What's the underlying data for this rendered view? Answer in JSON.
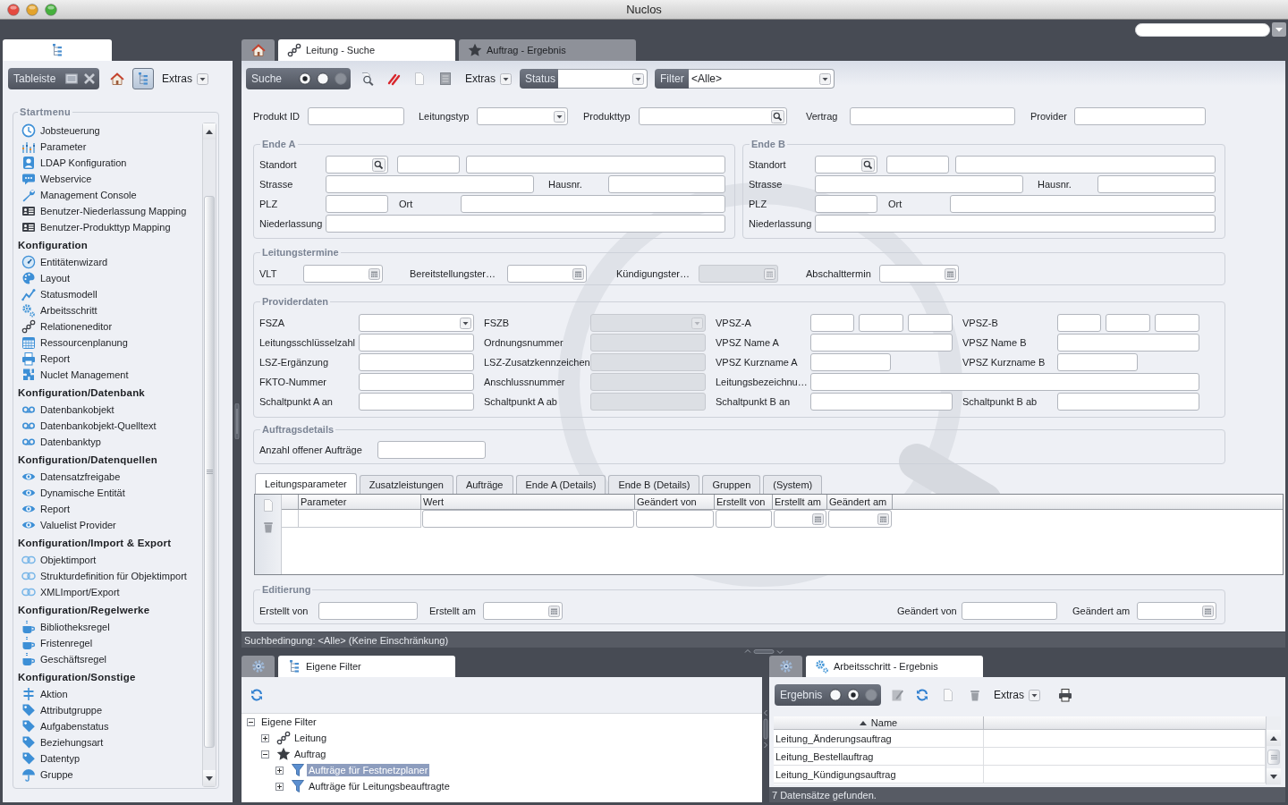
{
  "window": {
    "title": "Nuclos"
  },
  "sidebar": {
    "toolbar": {
      "label": "Tableiste",
      "tree_button_on": true,
      "extras": "Extras"
    },
    "startmenu": {
      "title": "Startmenu",
      "sections": [
        {
          "items": [
            {
              "label": "Jobsteuerung"
            },
            {
              "label": "Parameter"
            },
            {
              "label": "LDAP Konfiguration"
            },
            {
              "label": "Webservice"
            },
            {
              "label": "Management Console"
            },
            {
              "label": "Benutzer-Niederlassung Mapping"
            },
            {
              "label": "Benutzer-Produkttyp Mapping"
            }
          ]
        },
        {
          "heading": "Konfiguration",
          "items": [
            {
              "label": "Entitätenwizard"
            },
            {
              "label": "Layout"
            },
            {
              "label": "Statusmodell"
            },
            {
              "label": "Arbeitsschritt"
            },
            {
              "label": "Relationeneditor"
            },
            {
              "label": "Ressourcenplanung"
            },
            {
              "label": "Report"
            },
            {
              "label": "Nuclet Management"
            }
          ]
        },
        {
          "heading": "Konfiguration/Datenbank",
          "items": [
            {
              "label": "Datenbankobjekt"
            },
            {
              "label": "Datenbankobjekt-Quelltext"
            },
            {
              "label": "Datenbanktyp"
            }
          ]
        },
        {
          "heading": "Konfiguration/Datenquellen",
          "items": [
            {
              "label": "Datensatzfreigabe"
            },
            {
              "label": "Dynamische Entität"
            },
            {
              "label": "Report"
            },
            {
              "label": "Valuelist Provider"
            }
          ]
        },
        {
          "heading": "Konfiguration/Import & Export",
          "items": [
            {
              "label": "Objektimport"
            },
            {
              "label": "Strukturdefinition für Objektimport"
            },
            {
              "label": "XMLImport/Export"
            }
          ]
        },
        {
          "heading": "Konfiguration/Regelwerke",
          "items": [
            {
              "label": "Bibliotheksregel"
            },
            {
              "label": "Fristenregel"
            },
            {
              "label": "Geschäftsregel"
            }
          ]
        },
        {
          "heading": "Konfiguration/Sonstige",
          "items": [
            {
              "label": "Aktion"
            },
            {
              "label": "Attributgruppe"
            },
            {
              "label": "Aufgabenstatus"
            },
            {
              "label": "Beziehungsart"
            },
            {
              "label": "Datentyp"
            },
            {
              "label": "Gruppe"
            }
          ]
        }
      ]
    }
  },
  "main": {
    "tabs": [
      {
        "selected": false
      },
      {
        "label": "Leitung - Suche",
        "selected": true
      },
      {
        "label": "Auftrag - Ergebnis",
        "selected": false
      }
    ],
    "toolbar": {
      "mode": {
        "label": "Suche",
        "options": [
          {
            "selected": true,
            "disabled": false
          },
          {
            "selected": false,
            "disabled": false
          },
          {
            "selected": false,
            "disabled": true
          }
        ]
      },
      "extras": "Extras",
      "status": {
        "label": "Status"
      },
      "filter": {
        "label": "Filter",
        "value": "<Alle>"
      }
    },
    "search_fields": [
      {
        "label": "Produkt ID",
        "kind": "text"
      },
      {
        "label": "Leitungstyp",
        "kind": "combo"
      },
      {
        "label": "Produkttyp",
        "kind": "lookup"
      },
      {
        "label": "Vertrag",
        "kind": "text"
      },
      {
        "label": "Provider",
        "kind": "text"
      }
    ],
    "ends": [
      {
        "title": "Ende A",
        "standort": "Standort",
        "strasse": "Strasse",
        "hausnr": "Hausnr.",
        "plz": "PLZ",
        "ort": "Ort",
        "niederlassung": "Niederlassung"
      },
      {
        "title": "Ende B",
        "standort": "Standort",
        "strasse": "Strasse",
        "hausnr": "Hausnr.",
        "plz": "PLZ",
        "ort": "Ort",
        "niederlassung": "Niederlassung"
      }
    ],
    "leitungstermine": {
      "title": "Leitungstermine",
      "fields": [
        {
          "label": "VLT",
          "disabled": false
        },
        {
          "label": "Bereitstellungster…",
          "disabled": false
        },
        {
          "label": "Kündigungster…",
          "disabled": true
        },
        {
          "label": "Abschalttermin",
          "disabled": false
        }
      ]
    },
    "providerdaten": {
      "title": "Providerdaten",
      "rows": [
        [
          {
            "label": "FSZA",
            "kind": "combo",
            "disabled": false
          },
          {
            "label": "FSZB",
            "kind": "combo",
            "disabled": true
          },
          {
            "label": "VPSZ-A",
            "kind": "triple",
            "disabled": false
          },
          {
            "label": "VPSZ-B",
            "kind": "triple",
            "disabled": false
          }
        ],
        [
          {
            "label": "Leitungsschlüsselzahl",
            "kind": "text",
            "disabled": false
          },
          {
            "label": "Ordnungsnummer",
            "kind": "text",
            "disabled": true
          },
          {
            "label": "VPSZ Name A",
            "kind": "text",
            "disabled": false
          },
          {
            "label": "VPSZ Name B",
            "kind": "text",
            "disabled": false
          }
        ],
        [
          {
            "label": "LSZ-Ergänzung",
            "kind": "text",
            "disabled": false
          },
          {
            "label": "LSZ-Zusatzkennzeichen",
            "kind": "text",
            "disabled": true
          },
          {
            "label": "VPSZ Kurzname A",
            "kind": "short",
            "disabled": false
          },
          {
            "label": "VPSZ Kurzname B",
            "kind": "short",
            "disabled": false
          }
        ],
        [
          {
            "label": "FKTO-Nummer",
            "kind": "text",
            "disabled": false
          },
          {
            "label": "Anschlussnummer",
            "kind": "text",
            "disabled": true
          },
          {
            "label": "Leitungsbezeichnu…",
            "kind": "wide",
            "disabled": false
          }
        ],
        [
          {
            "label": "Schaltpunkt A an",
            "kind": "text",
            "disabled": false
          },
          {
            "label": "Schaltpunkt A ab",
            "kind": "text",
            "disabled": true
          },
          {
            "label": "Schaltpunkt B an",
            "kind": "text",
            "disabled": false
          },
          {
            "label": "Schaltpunkt B ab",
            "kind": "text",
            "disabled": false
          }
        ]
      ]
    },
    "auftragsdetails": {
      "title": "Auftragsdetails",
      "fields": [
        {
          "label": "Anzahl offener Aufträge"
        }
      ]
    },
    "subform": {
      "tabs": [
        {
          "label": "Leitungsparameter",
          "selected": true
        },
        {
          "label": "Zusatzleistungen",
          "selected": false
        },
        {
          "label": "Aufträge",
          "selected": false
        },
        {
          "label": "Ende A (Details)",
          "selected": false
        },
        {
          "label": "Ende B (Details)",
          "selected": false
        },
        {
          "label": "Gruppen",
          "selected": false
        },
        {
          "label": "(System)",
          "selected": false
        }
      ],
      "columns": [
        {
          "label": "Parameter",
          "kind": "plain"
        },
        {
          "label": "Wert",
          "kind": "text"
        },
        {
          "label": "Geändert von",
          "kind": "text"
        },
        {
          "label": "Erstellt von",
          "kind": "text"
        },
        {
          "label": "Erstellt am",
          "kind": "date"
        },
        {
          "label": "Geändert am",
          "kind": "date"
        }
      ]
    },
    "editierung": {
      "title": "Editierung",
      "left": [
        {
          "label": "Erstellt von",
          "kind": "text"
        },
        {
          "label": "Erstellt am",
          "kind": "date"
        }
      ],
      "right": [
        {
          "label": "Geändert von",
          "kind": "text"
        },
        {
          "label": "Geändert am",
          "kind": "date"
        }
      ]
    },
    "status_bar": "Suchbedingung: <Alle> (Keine Einschränkung)"
  },
  "filter_panel": {
    "tabs": [
      {
        "selected": false
      },
      {
        "label": "Eigene Filter",
        "selected": true
      }
    ],
    "tree": [
      {
        "label": "Eigene Filter",
        "expanded": true,
        "selected": false,
        "children": [
          {
            "label": "Leitung",
            "expanded": false,
            "selected": false
          },
          {
            "label": "Auftrag",
            "expanded": true,
            "selected": false,
            "children": [
              {
                "label": "Aufträge für Festnetzplaner",
                "expanded": false,
                "selected": true
              },
              {
                "label": "Aufträge für Leitungsbeauftragte",
                "expanded": false,
                "selected": false
              }
            ]
          }
        ]
      }
    ]
  },
  "result_panel": {
    "tabs": [
      {
        "selected": false
      },
      {
        "label": "Arbeitsschritt - Ergebnis",
        "selected": true
      }
    ],
    "toolbar": {
      "mode": {
        "label": "Ergebnis",
        "options": [
          {
            "selected": false,
            "disabled": false
          },
          {
            "selected": true,
            "disabled": false
          },
          {
            "selected": false,
            "disabled": true
          }
        ]
      },
      "extras": "Extras"
    },
    "table": {
      "columns": [
        {
          "label": "Name",
          "sort_ascending": true
        }
      ],
      "rows": [
        {
          "name": "Leitung_Änderungsauftrag"
        },
        {
          "name": "Leitung_Bestellauftrag"
        },
        {
          "name": "Leitung_Kündigungsauftrag"
        }
      ]
    },
    "status_bar": "7 Datensätze gefunden."
  }
}
